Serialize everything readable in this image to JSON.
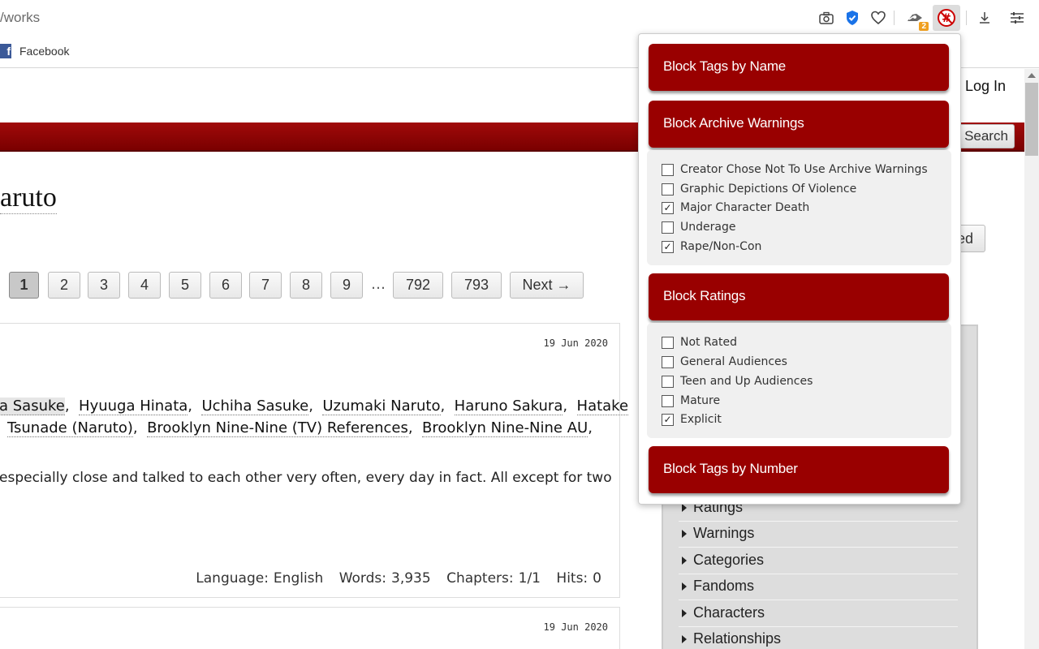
{
  "browser": {
    "url_fragment": "/works",
    "extension_badge": "2",
    "bookmarks": [
      {
        "label": "Facebook",
        "icon": "facebook-icon"
      }
    ]
  },
  "page": {
    "login_label": "Log In",
    "search_label": "Search",
    "heading": "aruto",
    "sidebar_button_fragment": "ed",
    "pagination": {
      "pages": [
        "1",
        "2",
        "3",
        "4",
        "5",
        "6",
        "7",
        "8",
        "9"
      ],
      "current": "1",
      "ellipsis": "…",
      "tail_pages": [
        "792",
        "793"
      ],
      "next_label": "Next →"
    },
    "works": [
      {
        "date": "19 Jun 2020",
        "tags_line1": [
          "a Sasuke",
          "Hyuuga Hinata",
          "Uchiha Sasuke",
          "Uzumaki Naruto",
          "Haruno Sakura",
          "Hatake"
        ],
        "tags_line2": [
          "Tsunade (Naruto)",
          "Brooklyn Nine-Nine (TV) References",
          "Brooklyn Nine-Nine AU"
        ],
        "summary": "especially close and talked to each other very often, every day in fact. All except for two",
        "stats": {
          "language_label": "Language:",
          "language": "English",
          "words_label": "Words:",
          "words": "3,935",
          "chapters_label": "Chapters:",
          "chapters": "1/1",
          "hits_label": "Hits:",
          "hits": "0"
        }
      },
      {
        "date": "19 Jun 2020"
      }
    ],
    "filters": [
      "Ratings",
      "Warnings",
      "Categories",
      "Fandoms",
      "Characters",
      "Relationships"
    ]
  },
  "popup": {
    "sections": {
      "by_name": "Block Tags by Name",
      "warnings": "Block Archive Warnings",
      "ratings": "Block Ratings",
      "by_number": "Block Tags by Number"
    },
    "warnings": [
      {
        "label": "Creator Chose Not To Use Archive Warnings",
        "checked": false
      },
      {
        "label": "Graphic Depictions Of Violence",
        "checked": false
      },
      {
        "label": "Major Character Death",
        "checked": true
      },
      {
        "label": "Underage",
        "checked": false
      },
      {
        "label": "Rape/Non-Con",
        "checked": true
      }
    ],
    "ratings": [
      {
        "label": "Not Rated",
        "checked": false
      },
      {
        "label": "General Audiences",
        "checked": false
      },
      {
        "label": "Teen and Up Audiences",
        "checked": false
      },
      {
        "label": "Mature",
        "checked": false
      },
      {
        "label": "Explicit",
        "checked": true
      }
    ],
    "check_glyph": "✓"
  },
  "colors": {
    "ao3_red": "#990000",
    "bar_red": "#a10a0a",
    "fb_blue": "#3b5998",
    "badge": "#f0a020"
  }
}
